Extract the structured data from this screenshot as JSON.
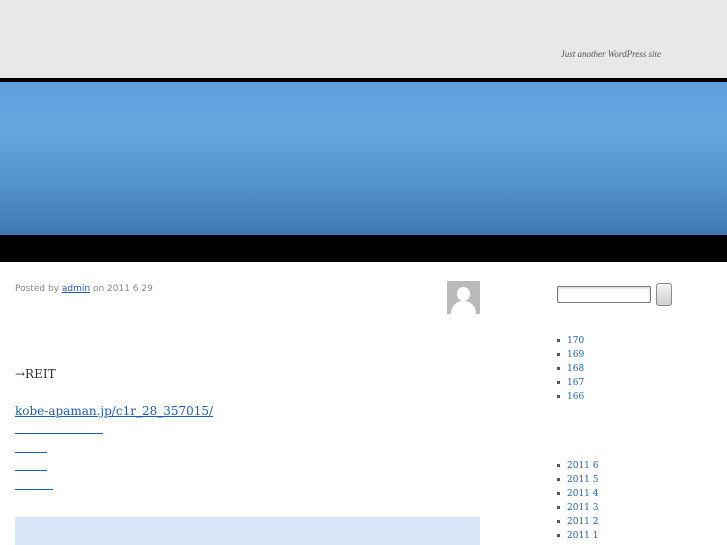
{
  "header": {
    "tagline": "Just another WordPress site"
  },
  "post": {
    "meta_prefix": "Posted by",
    "author": "admin",
    "meta_on": "on",
    "date": "2011 6 29",
    "text_line": "→REIT",
    "link": "kobe-apaman.jp/c1r_28_357015/"
  },
  "sidebar": {
    "recent_posts": [
      "170",
      "169",
      "168",
      "167",
      "166"
    ],
    "archives": [
      "2011 6",
      "2011 5",
      "2011 4",
      "2011 3",
      "2011 2",
      "2011 1"
    ]
  },
  "colors": {
    "link": "#1a5fb4",
    "banner": "#5f9ddc",
    "topbar": "#e8e8e8",
    "highlight_box": "#d8e8f8"
  }
}
